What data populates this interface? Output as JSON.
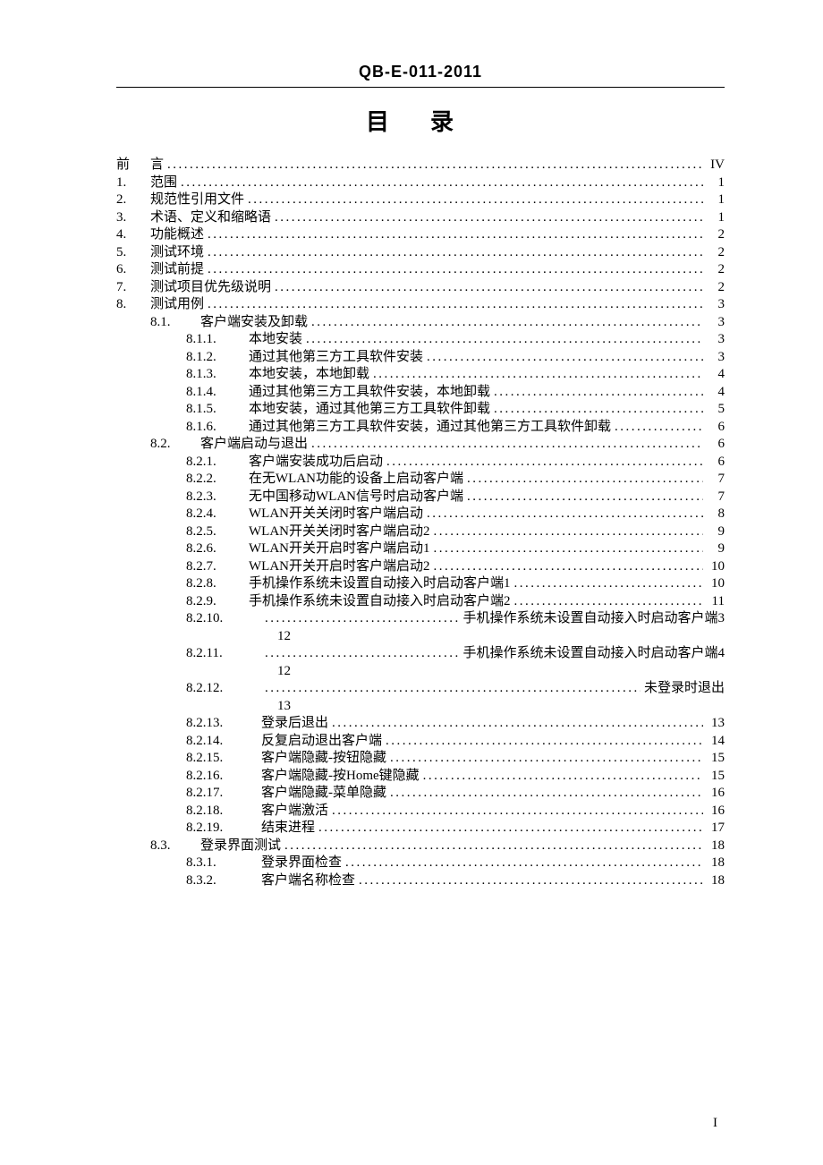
{
  "header": "QB-E-011-2011",
  "title_a": "目",
  "title_b": "录",
  "page_number": "I",
  "toc": [
    {
      "lvl": 0,
      "num": "前",
      "numclass": "toc-num",
      "text": "言",
      "page": "IV",
      "mode": "std"
    },
    {
      "lvl": 0,
      "num": "1.",
      "numclass": "toc-num",
      "text": "范围",
      "page": "1",
      "mode": "std"
    },
    {
      "lvl": 0,
      "num": "2.",
      "numclass": "toc-num",
      "text": "规范性引用文件",
      "page": "1",
      "mode": "std"
    },
    {
      "lvl": 0,
      "num": "3.",
      "numclass": "toc-num",
      "text": "术语、定义和缩略语",
      "page": "1",
      "mode": "std"
    },
    {
      "lvl": 0,
      "num": "4.",
      "numclass": "toc-num",
      "text": "功能概述",
      "page": "2",
      "mode": "std"
    },
    {
      "lvl": 0,
      "num": "5.",
      "numclass": "toc-num",
      "text": "测试环境",
      "page": "2",
      "mode": "std"
    },
    {
      "lvl": 0,
      "num": "6.",
      "numclass": "toc-num",
      "text": "测试前提",
      "page": "2",
      "mode": "std"
    },
    {
      "lvl": 0,
      "num": "7.",
      "numclass": "toc-num",
      "text": "测试项目优先级说明",
      "page": "2",
      "mode": "std"
    },
    {
      "lvl": 0,
      "num": "8.",
      "numclass": "toc-num",
      "text": "测试用例",
      "page": "3",
      "mode": "std"
    },
    {
      "lvl": 1,
      "num": "8.1.",
      "numclass": "toc-num toc-num2",
      "text": "客户端安装及卸载",
      "page": "3",
      "mode": "std"
    },
    {
      "lvl": 2,
      "num": "8.1.1.",
      "numclass": "toc-num toc-num3",
      "text": "本地安装",
      "page": "3",
      "mode": "std"
    },
    {
      "lvl": 2,
      "num": "8.1.2.",
      "numclass": "toc-num toc-num3",
      "text": "通过其他第三方工具软件安装",
      "page": "3",
      "mode": "std"
    },
    {
      "lvl": 2,
      "num": "8.1.3.",
      "numclass": "toc-num toc-num3",
      "text": "本地安装，本地卸载",
      "page": "4",
      "mode": "std"
    },
    {
      "lvl": 2,
      "num": "8.1.4.",
      "numclass": "toc-num toc-num3",
      "text": "通过其他第三方工具软件安装，本地卸载",
      "page": "4",
      "mode": "std"
    },
    {
      "lvl": 2,
      "num": "8.1.5.",
      "numclass": "toc-num toc-num3",
      "text": "本地安装，通过其他第三方工具软件卸载",
      "page": "5",
      "mode": "std"
    },
    {
      "lvl": 2,
      "num": "8.1.6.",
      "numclass": "toc-num toc-num3",
      "text": "通过其他第三方工具软件安装，通过其他第三方工具软件卸载",
      "page": "6",
      "mode": "std"
    },
    {
      "lvl": 1,
      "num": "8.2.",
      "numclass": "toc-num toc-num2",
      "text": "客户端启动与退出",
      "page": "6",
      "mode": "std"
    },
    {
      "lvl": 2,
      "num": "8.2.1.",
      "numclass": "toc-num toc-num3",
      "text": "客户端安装成功后启动",
      "page": "6",
      "mode": "std"
    },
    {
      "lvl": 2,
      "num": "8.2.2.",
      "numclass": "toc-num toc-num3",
      "text": "在无WLAN功能的设备上启动客户端",
      "page": "7",
      "mode": "std"
    },
    {
      "lvl": 2,
      "num": "8.2.3.",
      "numclass": "toc-num toc-num3",
      "text": "无中国移动WLAN信号时启动客户端",
      "page": "7",
      "mode": "std"
    },
    {
      "lvl": 2,
      "num": "8.2.4.",
      "numclass": "toc-num toc-num3",
      "text": "WLAN开关关闭时客户端启动",
      "page": "8",
      "mode": "std"
    },
    {
      "lvl": 2,
      "num": "8.2.5.",
      "numclass": "toc-num toc-num3",
      "text": "WLAN开关关闭时客户端启动2",
      "page": "9",
      "mode": "std"
    },
    {
      "lvl": 2,
      "num": "8.2.6.",
      "numclass": "toc-num toc-num3",
      "text": "WLAN开关开启时客户端启动1",
      "page": "9",
      "mode": "std"
    },
    {
      "lvl": 2,
      "num": "8.2.7.",
      "numclass": "toc-num toc-num3",
      "text": "WLAN开关开启时客户端启动2",
      "page": "10",
      "mode": "std"
    },
    {
      "lvl": 2,
      "num": "8.2.8.",
      "numclass": "toc-num toc-num3",
      "text": "手机操作系统未设置自动接入时启动客户端1",
      "page": "10",
      "mode": "std"
    },
    {
      "lvl": 2,
      "num": "8.2.9.",
      "numclass": "toc-num toc-num3",
      "text": "手机操作系统未设置自动接入时启动客户端2",
      "page": "11",
      "mode": "std"
    },
    {
      "lvl": 2,
      "num": "8.2.10.",
      "numclass": "toc-num toc-num3b",
      "text": "手机操作系统未设置自动接入时启动客户端3",
      "page": "12",
      "mode": "wrap"
    },
    {
      "lvl": 2,
      "num": "8.2.11.",
      "numclass": "toc-num toc-num3b",
      "text": "手机操作系统未设置自动接入时启动客户端4",
      "page": "12",
      "mode": "wrap"
    },
    {
      "lvl": 2,
      "num": "8.2.12.",
      "numclass": "toc-num toc-num3b",
      "text": "未登录时退出",
      "page": "13",
      "mode": "wrap"
    },
    {
      "lvl": 2,
      "num": "8.2.13.",
      "numclass": "toc-num toc-num3b",
      "text": "登录后退出",
      "page": "13",
      "mode": "std"
    },
    {
      "lvl": 2,
      "num": "8.2.14.",
      "numclass": "toc-num toc-num3b",
      "text": "反复启动退出客户端",
      "page": "14",
      "mode": "std"
    },
    {
      "lvl": 2,
      "num": "8.2.15.",
      "numclass": "toc-num toc-num3b",
      "text": "客户端隐藏-按钮隐藏",
      "page": "15",
      "mode": "std"
    },
    {
      "lvl": 2,
      "num": "8.2.16.",
      "numclass": "toc-num toc-num3b",
      "text": "客户端隐藏-按Home键隐藏",
      "page": "15",
      "mode": "std"
    },
    {
      "lvl": 2,
      "num": "8.2.17.",
      "numclass": "toc-num toc-num3b",
      "text": "客户端隐藏-菜单隐藏",
      "page": "16",
      "mode": "std"
    },
    {
      "lvl": 2,
      "num": "8.2.18.",
      "numclass": "toc-num toc-num3b",
      "text": "客户端激活",
      "page": "16",
      "mode": "std"
    },
    {
      "lvl": 2,
      "num": "8.2.19.",
      "numclass": "toc-num toc-num3b",
      "text": "结束进程",
      "page": "17",
      "mode": "std"
    },
    {
      "lvl": 1,
      "num": "8.3.",
      "numclass": "toc-num toc-num2",
      "text": "登录界面测试",
      "page": "18",
      "mode": "std"
    },
    {
      "lvl": 2,
      "num": "8.3.1.",
      "numclass": "toc-num toc-num3b",
      "text": "登录界面检查",
      "page": "18",
      "mode": "std"
    },
    {
      "lvl": 2,
      "num": "8.3.2.",
      "numclass": "toc-num toc-num3b",
      "text": "客户端名称检查",
      "page": "18",
      "mode": "std"
    }
  ]
}
